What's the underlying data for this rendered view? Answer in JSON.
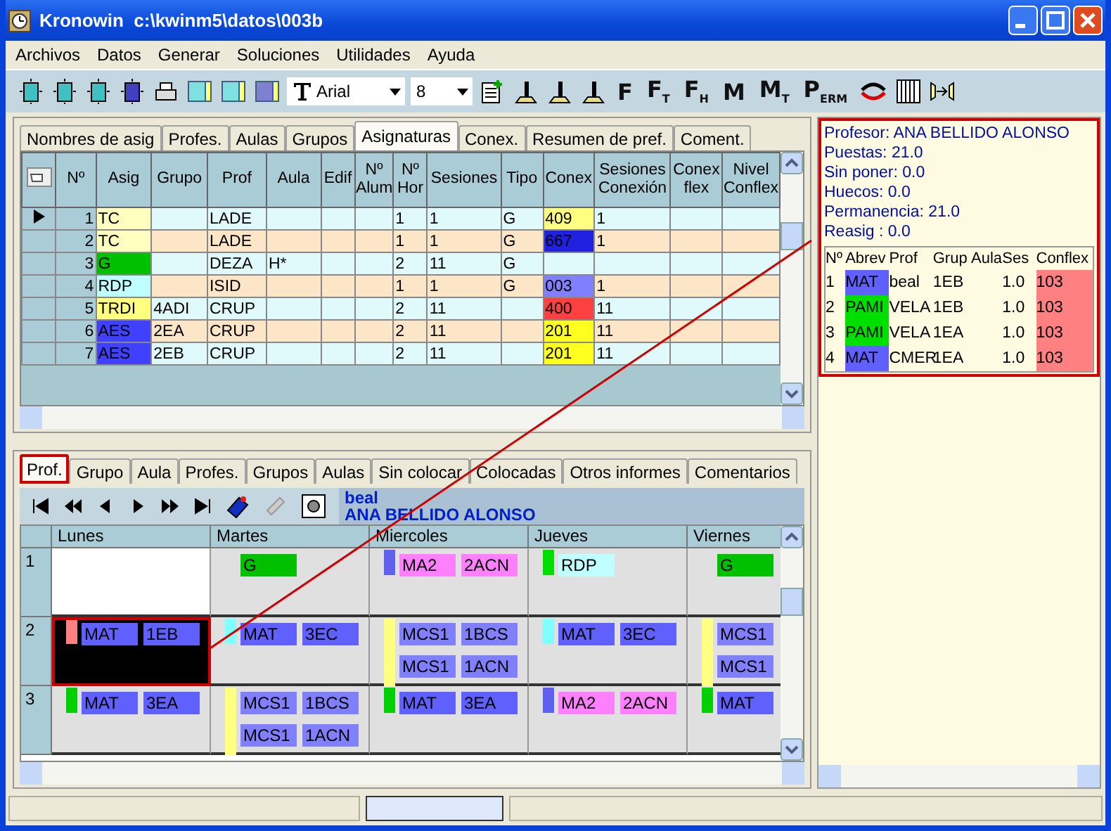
{
  "window": {
    "title": "Kronowin  c:\\kwinm5\\datos\\003b"
  },
  "menu": [
    "Archivos",
    "Datos",
    "Generar",
    "Soluciones",
    "Utilidades",
    "Ayuda"
  ],
  "toolbar": {
    "font": "Arial",
    "size": "8",
    "letter_buttons": [
      "F",
      "F$_{T}$",
      "F$_{H}$",
      "M",
      "M$_{T}$",
      "P$_{ERM}$"
    ]
  },
  "upper_tabs": [
    {
      "label": "Nombres de asig",
      "selected": false
    },
    {
      "label": "Profes.",
      "selected": false
    },
    {
      "label": "Aulas",
      "selected": false
    },
    {
      "label": "Grupos",
      "selected": false
    },
    {
      "label": "Asignaturas",
      "selected": true
    },
    {
      "label": "Conex.",
      "selected": false
    },
    {
      "label": "Resumen de pref.",
      "selected": false
    },
    {
      "label": "Coment.",
      "selected": false
    }
  ],
  "table": {
    "columns": [
      "Nº",
      "Asig",
      "Grupo",
      "Prof",
      "Aula",
      "Edif",
      "Nº\nAlum",
      "Nº\nHor",
      "Sesiones",
      "Tipo",
      "Conex",
      "Sesiones\nConexión",
      "Conex\nflex",
      "Nivel\nConflex"
    ],
    "rows": [
      {
        "current": true,
        "cells": [
          "1",
          {
            "text": "TC",
            "color": "#ffffc0"
          },
          "",
          "LADE",
          "",
          "",
          "",
          "1",
          "1",
          "G",
          {
            "text": "409",
            "color": "#ffff80"
          },
          "1",
          "",
          ""
        ]
      },
      {
        "current": false,
        "cells": [
          "2",
          {
            "text": "TC",
            "color": "#ffffc0"
          },
          "",
          "LADE",
          "",
          "",
          "",
          "1",
          "1",
          "G",
          {
            "text": "667",
            "color": "#2020e0"
          },
          "1",
          "",
          ""
        ]
      },
      {
        "current": false,
        "cells": [
          "3",
          {
            "text": "G",
            "color": "#00c000"
          },
          "",
          "DEZA",
          "H*",
          "",
          "",
          "2",
          "11",
          "G",
          "",
          "",
          "",
          ""
        ]
      },
      {
        "current": false,
        "cells": [
          "4",
          {
            "text": "RDP",
            "color": "#c0ffff"
          },
          "",
          "ISID",
          "",
          "",
          "",
          "1",
          "1",
          "G",
          {
            "text": "003",
            "color": "#8080ff"
          },
          "1",
          "",
          ""
        ]
      },
      {
        "current": false,
        "cells": [
          "5",
          {
            "text": "TRDI",
            "color": "#ffff80"
          },
          "4ADI",
          "CRUP",
          "",
          "",
          "",
          "2",
          "11",
          "",
          {
            "text": "400",
            "color": "#ff4040"
          },
          "11",
          "",
          ""
        ]
      },
      {
        "current": false,
        "cells": [
          "6",
          {
            "text": "AES",
            "color": "#4040ff"
          },
          "2EA",
          "CRUP",
          "",
          "",
          "",
          "2",
          "11",
          "",
          {
            "text": "201",
            "color": "#ffff20"
          },
          "11",
          "",
          ""
        ]
      },
      {
        "current": false,
        "cells": [
          "7",
          {
            "text": "AES",
            "color": "#4040ff"
          },
          "2EB",
          "CRUP",
          "",
          "",
          "",
          "2",
          "11",
          "",
          {
            "text": "201",
            "color": "#ffff20"
          },
          "11",
          "",
          ""
        ]
      }
    ]
  },
  "lower_tabs": [
    {
      "label": "Prof.",
      "selected": true
    },
    {
      "label": "Grupo",
      "selected": false
    },
    {
      "label": "Aula",
      "selected": false
    },
    {
      "label": "Profes.",
      "selected": false
    },
    {
      "label": "Grupos",
      "selected": false
    },
    {
      "label": "Aulas",
      "selected": false
    },
    {
      "label": "Sin colocar",
      "selected": false
    },
    {
      "label": "Colocadas",
      "selected": false
    },
    {
      "label": "Otros informes",
      "selected": false
    },
    {
      "label": "Comentarios",
      "selected": false
    }
  ],
  "teacher": {
    "code": "beal",
    "name": "ANA BELLIDO ALONSO"
  },
  "timetable": {
    "days": [
      "Lunes",
      "Martes",
      "Miercoles",
      "Jueves",
      "Viernes"
    ],
    "periods": [
      {
        "label": "1",
        "cells": [
          {
            "selected": false,
            "free": true
          },
          {
            "selected": false,
            "free": false,
            "lines": [
              {
                "subject": "G",
                "color": "#00c000"
              }
            ]
          },
          {
            "selected": false,
            "free": false,
            "marker": {
              "color": "#6060f0"
            },
            "lines": [
              {
                "subject": "MA2",
                "group": "2ACN",
                "color": "#ff80ff"
              }
            ]
          },
          {
            "selected": false,
            "free": false,
            "marker": {
              "color": "#00e000"
            },
            "lines": [
              {
                "subject": "RDP",
                "color": "#c0ffff"
              }
            ]
          },
          {
            "selected": false,
            "free": false,
            "lines": [
              {
                "subject": "G",
                "color": "#00c000"
              }
            ]
          }
        ]
      },
      {
        "label": "2",
        "cells": [
          {
            "selected": true,
            "free": false,
            "marker": {
              "color": "#ff8080"
            },
            "lines": [
              {
                "subject": "MAT",
                "group": "1EB",
                "color": "#6060ff"
              }
            ]
          },
          {
            "selected": false,
            "free": false,
            "marker": {
              "color": "#80ffff"
            },
            "lines": [
              {
                "subject": "MAT",
                "group": "3EC",
                "color": "#6060ff"
              }
            ]
          },
          {
            "selected": false,
            "free": false,
            "marker": {
              "color": "#ffff80"
            },
            "lines": [
              {
                "subject": "MCS1",
                "group": "1BCS",
                "color": "#8080ff"
              },
              {
                "subject": "MCS1",
                "group": "1ACN",
                "color": "#8080ff"
              }
            ]
          },
          {
            "selected": false,
            "free": false,
            "marker": {
              "color": "#80ffff"
            },
            "lines": [
              {
                "subject": "MAT",
                "group": "3EC",
                "color": "#6060ff"
              }
            ]
          },
          {
            "selected": false,
            "free": false,
            "marker": {
              "color": "#ffff80"
            },
            "lines": [
              {
                "subject": "MCS1",
                "color": "#8080ff"
              },
              {
                "subject": "MCS1",
                "color": "#8080ff"
              }
            ]
          }
        ]
      },
      {
        "label": "3",
        "cells": [
          {
            "selected": false,
            "free": false,
            "marker": {
              "color": "#00d000"
            },
            "lines": [
              {
                "subject": "MAT",
                "group": "3EA",
                "color": "#6060ff"
              }
            ]
          },
          {
            "selected": false,
            "free": false,
            "marker": {
              "color": "#ffff80"
            },
            "lines": [
              {
                "subject": "MCS1",
                "group": "1BCS",
                "color": "#8080ff"
              },
              {
                "subject": "MCS1",
                "group": "1ACN",
                "color": "#8080ff"
              }
            ]
          },
          {
            "selected": false,
            "free": false,
            "marker": {
              "color": "#00d000"
            },
            "lines": [
              {
                "subject": "MAT",
                "group": "3EA",
                "color": "#6060ff"
              }
            ]
          },
          {
            "selected": false,
            "free": false,
            "marker": {
              "color": "#6060f0"
            },
            "lines": [
              {
                "subject": "MA2",
                "group": "2ACN",
                "color": "#ff80ff"
              }
            ]
          },
          {
            "selected": false,
            "free": false,
            "marker": {
              "color": "#00d000"
            },
            "lines": [
              {
                "subject": "MAT",
                "color": "#6060ff"
              }
            ]
          }
        ]
      }
    ]
  },
  "info": [
    "Profesor: ANA BELLIDO ALONSO",
    "Puestas: 21.0",
    "Sin poner: 0.0",
    "Huecos: 0.0",
    "Permanencia: 21.0",
    "Reasig : 0.0"
  ],
  "conflicts": {
    "columns": [
      "Nº",
      "Abrev",
      "Prof",
      "Grup",
      "Aula",
      "Ses",
      "Conflex"
    ],
    "rows": [
      {
        "cells": [
          "1",
          {
            "text": "MAT",
            "color": "#6060ff"
          },
          "beal",
          "1EB",
          "",
          "1.0",
          "103"
        ]
      },
      {
        "cells": [
          "2",
          {
            "text": "PAMI",
            "color": "#00e000"
          },
          "VELA",
          "1EB",
          "",
          "1.0",
          "103"
        ]
      },
      {
        "cells": [
          "3",
          {
            "text": "PAMI",
            "color": "#00e000"
          },
          "VELA",
          "1EA",
          "",
          "1.0",
          "103"
        ]
      },
      {
        "cells": [
          "4",
          {
            "text": "MAT",
            "color": "#6060ff"
          },
          "CMER",
          "1EA",
          "",
          "1.0",
          "103"
        ]
      }
    ]
  }
}
